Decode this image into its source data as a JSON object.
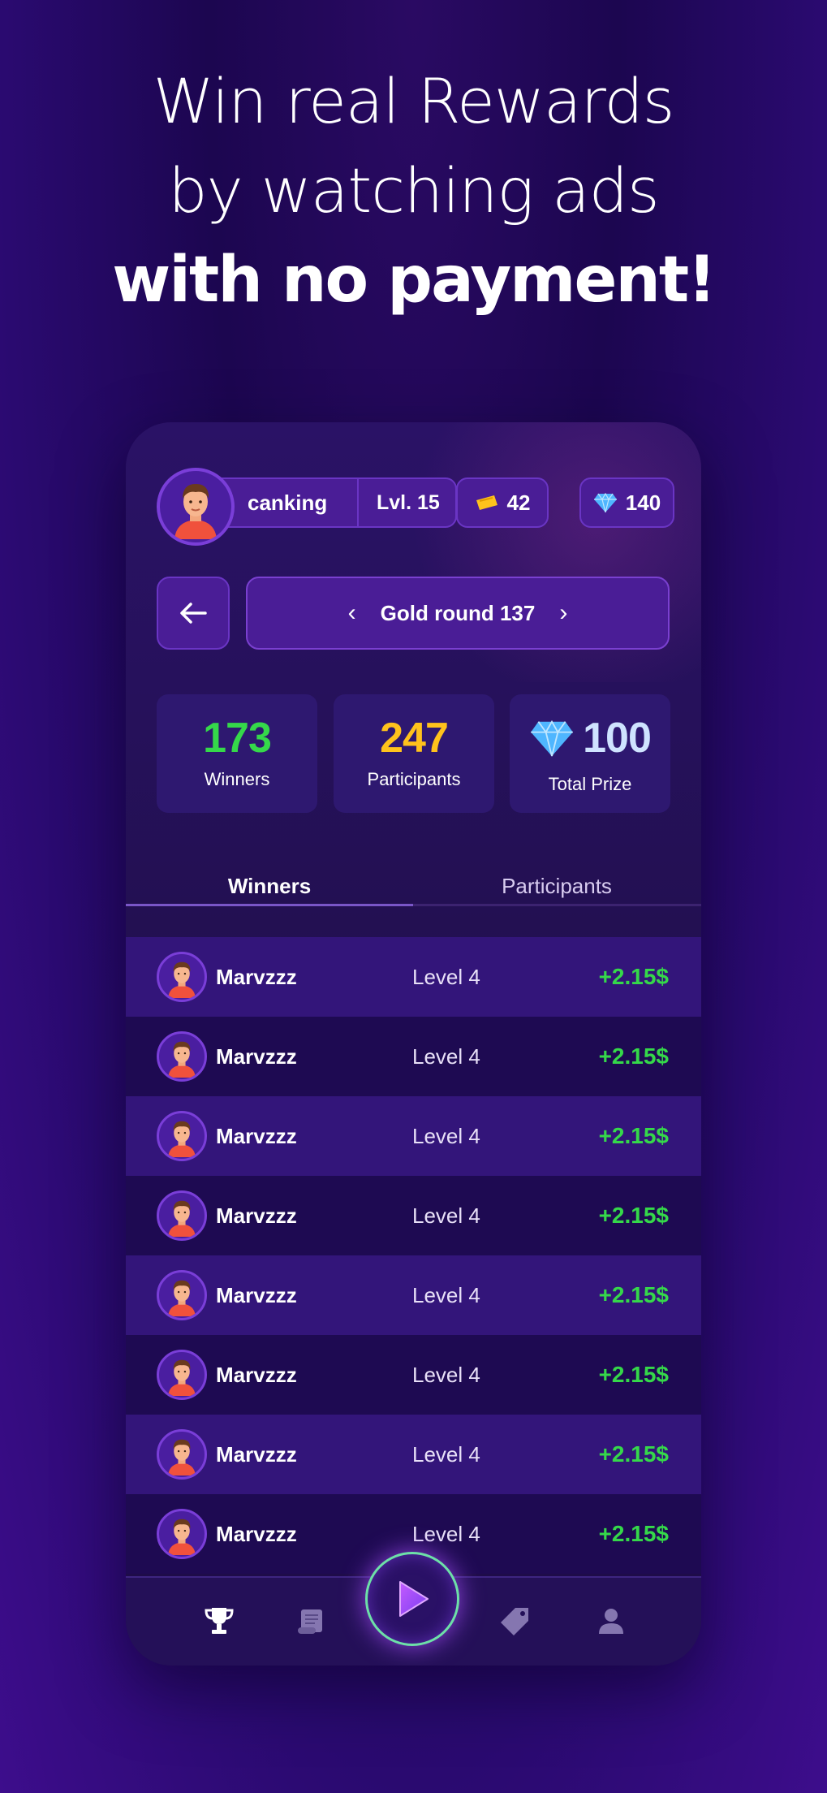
{
  "headline": {
    "line1": "Win real Rewards",
    "line2": "by watching ads",
    "line3": "with no payment!"
  },
  "header": {
    "username": "canking",
    "level": "Lvl. 15",
    "tickets": "42",
    "gems": "140"
  },
  "round": {
    "title": "Gold round 137",
    "prev": "‹",
    "next": "›"
  },
  "stats": {
    "winners": {
      "value": "173",
      "label": "Winners"
    },
    "participants": {
      "value": "247",
      "label": "Participants"
    },
    "prize": {
      "value": "100",
      "label": "Total Prize"
    }
  },
  "tabs": {
    "winners": "Winners",
    "participants": "Participants"
  },
  "rows": [
    {
      "name": "Marvzzz",
      "level": "Level 4",
      "amount": "+2.15$"
    },
    {
      "name": "Marvzzz",
      "level": "Level 4",
      "amount": "+2.15$"
    },
    {
      "name": "Marvzzz",
      "level": "Level 4",
      "amount": "+2.15$"
    },
    {
      "name": "Marvzzz",
      "level": "Level 4",
      "amount": "+2.15$"
    },
    {
      "name": "Marvzzz",
      "level": "Level 4",
      "amount": "+2.15$"
    },
    {
      "name": "Marvzzz",
      "level": "Level 4",
      "amount": "+2.15$"
    },
    {
      "name": "Marvzzz",
      "level": "Level 4",
      "amount": "+2.15$"
    },
    {
      "name": "Marvzzz",
      "level": "Level 4",
      "amount": "+2.15$"
    }
  ],
  "nav": [
    "trophy-icon",
    "scroll-icon",
    "play-icon",
    "tag-icon",
    "user-icon"
  ],
  "colors": {
    "positive": "#35d84a",
    "participants": "#ffc21c",
    "accent": "#7a3ed8"
  }
}
